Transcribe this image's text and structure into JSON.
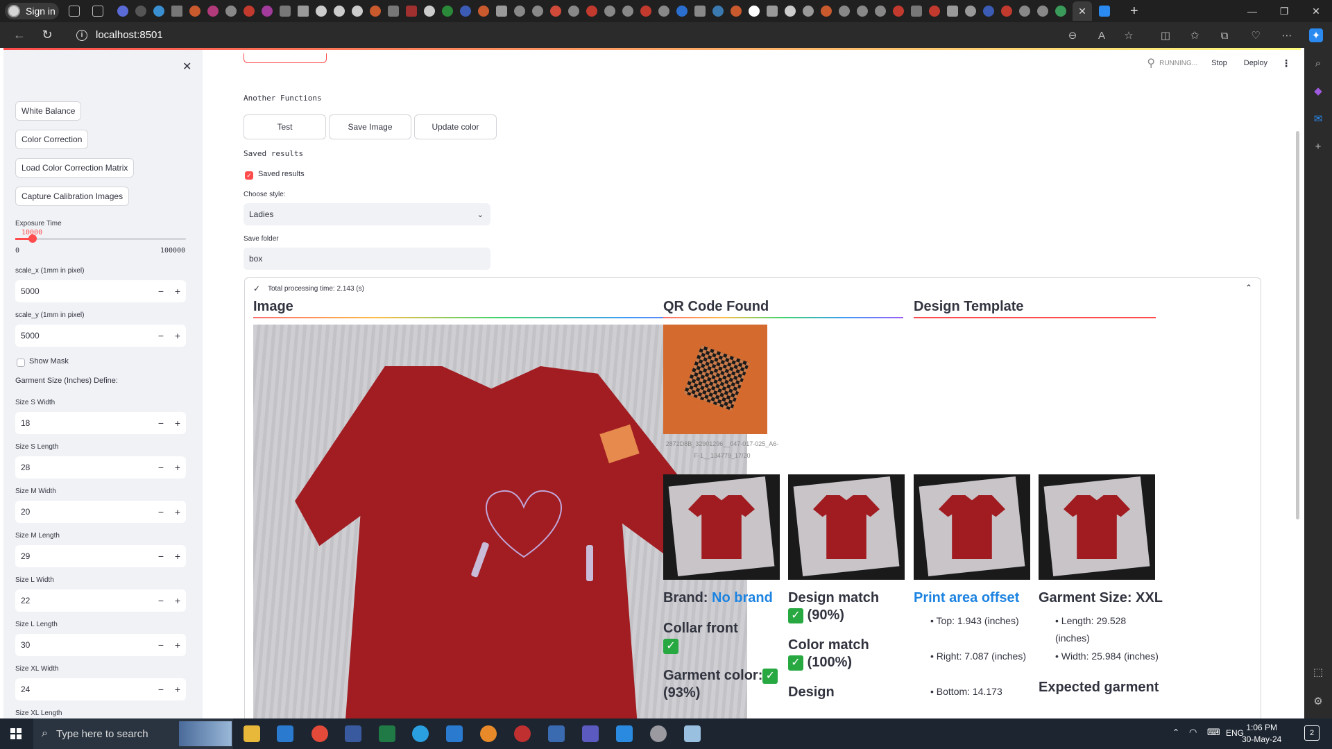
{
  "browser": {
    "signin_label": "Sign in",
    "url": "localhost:8501"
  },
  "header": {
    "running_label": "RUNNING...",
    "stop_label": "Stop",
    "deploy_label": "Deploy"
  },
  "sidebar": {
    "buttons": [
      "White Balance",
      "Color Correction",
      "Load Color Correction Matrix",
      "Capture Calibration Images"
    ],
    "exposure": {
      "label": "Exposure Time",
      "value": "10000",
      "min": "0",
      "max": "100000",
      "fraction": 0.1
    },
    "scale_x": {
      "label": "scale_x (1mm in pixel)",
      "value": "5000"
    },
    "scale_y": {
      "label": "scale_y (1mm in pixel)",
      "value": "5000"
    },
    "show_mask_label": "Show Mask",
    "garment_define_label": "Garment Size (Inches) Define:",
    "sizes": [
      {
        "label": "Size S Width",
        "value": "18"
      },
      {
        "label": "Size S Length",
        "value": "28"
      },
      {
        "label": "Size M Width",
        "value": "20"
      },
      {
        "label": "Size M Length",
        "value": "29"
      },
      {
        "label": "Size L Width",
        "value": "22"
      },
      {
        "label": "Size L Length",
        "value": "30"
      },
      {
        "label": "Size XL Width",
        "value": "24"
      },
      {
        "label": "Size XL Length",
        "value": ""
      }
    ]
  },
  "main": {
    "another_functions_label": "Another Functions",
    "buttons": [
      "Test",
      "Save Image",
      "Update color"
    ],
    "saved_results_label": "Saved results",
    "saved_results_checkbox": "Saved results",
    "choose_style_label": "Choose style:",
    "choose_style_value": "Ladies",
    "save_folder_label": "Save folder",
    "save_folder_value": "box",
    "processing_time": "Total processing time: 2.143 (s)"
  },
  "results": {
    "image_heading": "Image",
    "qr_heading": "QR Code Found",
    "qr_caption": "2872D8B_32901296__047-017-025_A6-F-1__134779_17/20",
    "design_heading": "Design Template",
    "brand_label": "Brand:",
    "brand_value": "No brand",
    "collar_label": "Collar front",
    "garment_color_label": "Garment color:",
    "garment_color_value": "(93%)",
    "design_match_label": "Design match",
    "design_match_value": "(90%)",
    "color_match_label": "Color match",
    "color_match_value": "(100%)",
    "design_label": "Design",
    "print_offset_heading": "Print area offset",
    "print_offset": [
      "Top: 1.943 (inches)",
      "Right: 7.087 (inches)",
      "Bottom: 14.173"
    ],
    "garment_size_heading": "Garment Size: XXL",
    "garment_size": [
      "Length: 29.528 (inches)",
      "Width: 25.984 (inches)"
    ],
    "expected_label": "Expected garment"
  },
  "taskbar": {
    "search_placeholder": "Type here to search",
    "language": "ENG",
    "time": "1:06 PM",
    "date": "30-May-24",
    "notifications": "2"
  }
}
